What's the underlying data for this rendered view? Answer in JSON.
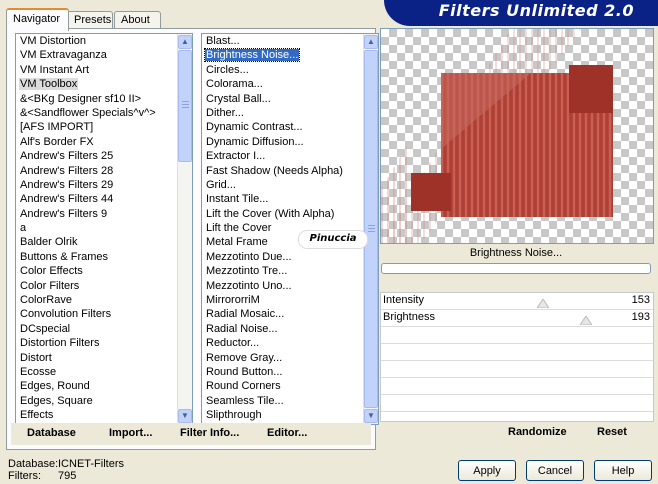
{
  "tabs": [
    "Navigator",
    "Presets",
    "About"
  ],
  "banner": {
    "title": "Filters Unlimited 2.0"
  },
  "categories": [
    "VM Distortion",
    "VM Extravaganza",
    "VM Instant Art",
    "VM Toolbox",
    "&<BKg Designer sf10 II>",
    "&<Sandflower Specials^v^>",
    "[AFS IMPORT]",
    "Alf's Border FX",
    "Andrew's Filters 25",
    "Andrew's Filters 28",
    "Andrew's Filters 29",
    "Andrew's Filters 44",
    "Andrew's Filters 9",
    "a",
    "Balder Olrik",
    "Buttons & Frames",
    "Color Effects",
    "Color Filters",
    "ColorRave",
    "Convolution Filters",
    "DCspecial",
    "Distortion Filters",
    "Distort",
    "Ecosse",
    "Edges, Round",
    "Edges, Square",
    "Effects"
  ],
  "categories_selected": "VM Toolbox",
  "filters": [
    "Blast...",
    "Brightness Noise...",
    "Circles...",
    "Colorama...",
    "Crystal Ball...",
    "Dither...",
    "Dynamic Contrast...",
    "Dynamic Diffusion...",
    "Extractor I...",
    "Fast Shadow (Needs Alpha)",
    "Grid...",
    "Instant Tile...",
    "Lift the Cover (With Alpha)",
    "Lift the Cover",
    "Metal Frame",
    "Mezzotinto Due...",
    "Mezzotinto Tre...",
    "Mezzotinto Uno...",
    "MirrororriM",
    "Radial Mosaic...",
    "Radial Noise...",
    "Reductor...",
    "Remove Gray...",
    "Round Button...",
    "Round Corners",
    "Seamless Tile...",
    "Slipthrough"
  ],
  "filters_selected": "Brightness Noise...",
  "bottom_left_buttons": [
    "Database",
    "Import...",
    "Filter Info...",
    "Editor..."
  ],
  "filter_name": "Brightness Noise...",
  "params": [
    {
      "label": "Intensity",
      "value": "153",
      "fraction": 0.6
    },
    {
      "label": "Brightness",
      "value": "193",
      "fraction": 0.757
    }
  ],
  "bottom_right_buttons": [
    "Randomize",
    "Reset"
  ],
  "status": {
    "db_label": "Database:",
    "db_value": "ICNET-Filters",
    "f_label": "Filters:",
    "f_value": "795"
  },
  "dialog_buttons": {
    "apply": "Apply",
    "cancel": "Cancel",
    "help": "Help"
  },
  "watermark": "Pinuccia",
  "colors": {
    "banner": "#0a2286",
    "accent": "#e68b2c",
    "selection": "#316ac5",
    "preview_red": "#b8453a"
  }
}
